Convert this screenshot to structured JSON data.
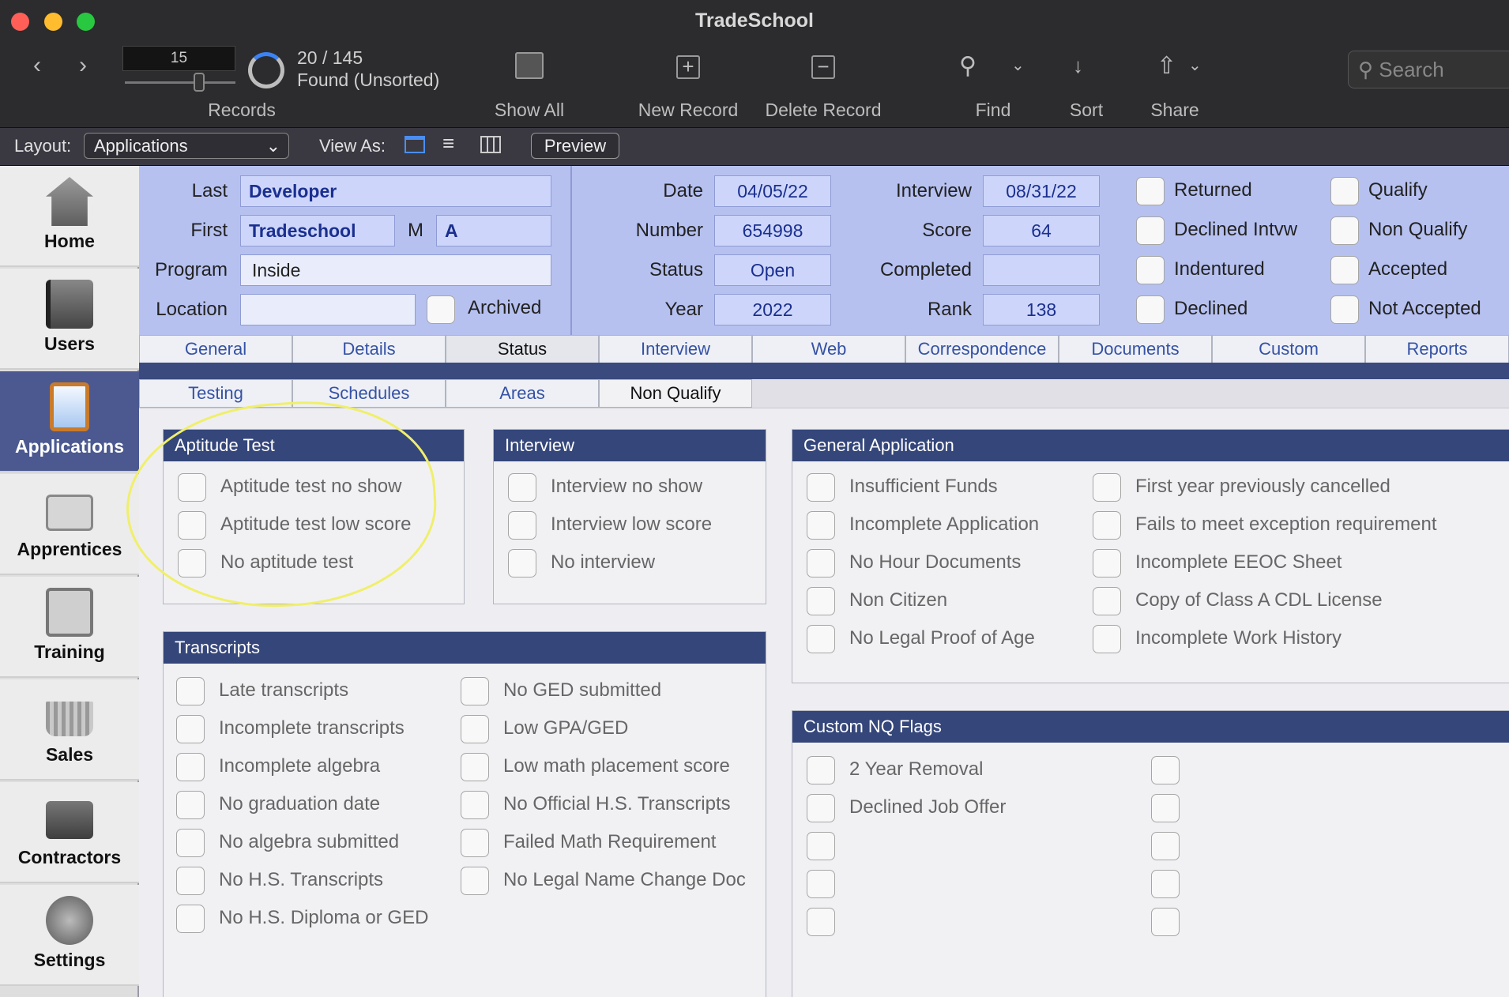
{
  "window": {
    "title": "TradeSchool"
  },
  "toolbar": {
    "records_value": "15",
    "records_label": "Records",
    "found_count": "20 / 145",
    "found_status": "Found (Unsorted)",
    "show_all": "Show All",
    "new_record": "New Record",
    "delete_record": "Delete Record",
    "find": "Find",
    "sort": "Sort",
    "share": "Share",
    "search_placeholder": "Search"
  },
  "layoutbar": {
    "layout_label": "Layout:",
    "layout_value": "Applications",
    "view_as": "View As:",
    "preview": "Preview"
  },
  "sidebar": {
    "items": [
      {
        "label": "Home",
        "icon": "house-icon"
      },
      {
        "label": "Users",
        "icon": "address-book-icon"
      },
      {
        "label": "Applications",
        "icon": "clipboard-icon"
      },
      {
        "label": "Apprentices",
        "icon": "id-card-icon"
      },
      {
        "label": "Training",
        "icon": "certificate-icon"
      },
      {
        "label": "Sales",
        "icon": "basket-icon"
      },
      {
        "label": "Contractors",
        "icon": "briefcase-icon"
      },
      {
        "label": "Settings",
        "icon": "wrench-icon"
      }
    ]
  },
  "record": {
    "last_label": "Last",
    "last": "Developer",
    "first_label": "First",
    "first": "Tradeschool",
    "middle_label": "M",
    "middle": "A",
    "program_label": "Program",
    "program": "Inside",
    "location_label": "Location",
    "location": "",
    "archived_label": "Archived",
    "date_label": "Date",
    "date": "04/05/22",
    "number_label": "Number",
    "number": "654998",
    "status_label": "Status",
    "status": "Open",
    "year_label": "Year",
    "year": "2022",
    "interview_label": "Interview",
    "interview": "08/31/22",
    "score_label": "Score",
    "score": "64",
    "completed_label": "Completed",
    "completed": "",
    "rank_label": "Rank",
    "rank": "138",
    "flags_col1": [
      "Returned",
      "Declined Intvw",
      "Indentured",
      "Declined"
    ],
    "flags_col2": [
      "Qualify",
      "Non Qualify",
      "Accepted",
      "Not Accepted"
    ]
  },
  "tabs": [
    "General",
    "Details",
    "Status",
    "Interview",
    "Web",
    "Correspondence",
    "Documents",
    "Custom",
    "Reports"
  ],
  "subtabs": [
    "Testing",
    "Schedules",
    "Areas",
    "Non Qualify"
  ],
  "panels": {
    "aptitude": {
      "title": "Aptitude Test",
      "items": [
        "Aptitude test no show",
        "Aptitude test low score",
        "No aptitude test"
      ]
    },
    "interview": {
      "title": "Interview",
      "items": [
        "Interview no show",
        "Interview low score",
        "No interview"
      ]
    },
    "general": {
      "title": "General Application",
      "left": [
        "Insufficient Funds",
        "Incomplete Application",
        "No Hour Documents",
        "Non Citizen",
        "No Legal Proof of Age"
      ],
      "right": [
        "First year previously cancelled",
        "Fails to meet exception requirement",
        "Incomplete EEOC Sheet",
        "Copy of Class A CDL License",
        "Incomplete Work History"
      ]
    },
    "transcripts": {
      "title": "Transcripts",
      "left": [
        "Late transcripts",
        "Incomplete transcripts",
        "Incomplete algebra",
        "No graduation date",
        "No algebra submitted",
        "No H.S. Transcripts",
        "No H.S. Diploma or GED"
      ],
      "right": [
        "No GED submitted",
        "Low GPA/GED",
        "Low math placement score",
        "No Official H.S. Transcripts",
        "Failed Math Requirement",
        "No Legal Name Change Doc"
      ]
    },
    "custom": {
      "title": "Custom NQ Flags",
      "left": [
        "2 Year Removal",
        "Declined Job Offer",
        "",
        "",
        ""
      ],
      "right": [
        "",
        "",
        "",
        "",
        ""
      ]
    }
  },
  "colors": {
    "accent": "#34467a",
    "header_bg": "#b6c1f0",
    "active_nav": "#4b5990",
    "annotation": "#f0ef6a"
  }
}
